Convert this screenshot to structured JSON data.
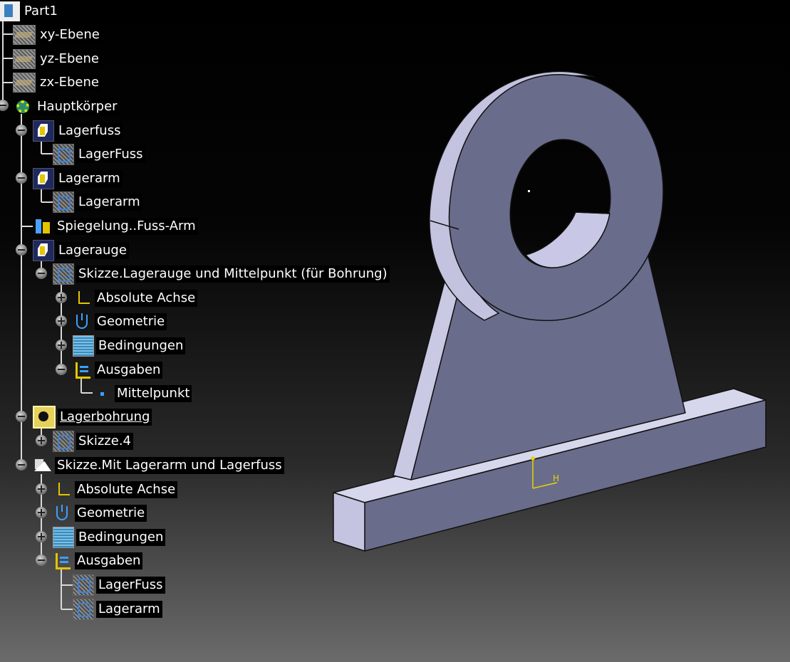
{
  "tree": {
    "root": {
      "label": "Part1",
      "icon": "part-icon"
    },
    "nodes": [
      {
        "label": "xy-Ebene",
        "icon": "plane-icon"
      },
      {
        "label": "yz-Ebene",
        "icon": "plane-icon"
      },
      {
        "label": "zx-Ebene",
        "icon": "plane-icon"
      },
      {
        "label": "Hauptkörper",
        "icon": "body-icon"
      },
      {
        "label": "Lagerfuss",
        "icon": "pad-icon"
      },
      {
        "label": "LagerFuss",
        "icon": "sketch-icon"
      },
      {
        "label": "Lagerarm",
        "icon": "pad-icon"
      },
      {
        "label": "Lagerarm",
        "icon": "sketch-icon"
      },
      {
        "label": "Spiegelung..Fuss-Arm",
        "icon": "mirror-icon"
      },
      {
        "label": "Lagerauge",
        "icon": "pad-icon"
      },
      {
        "label": "Skizze.Lagerauge und Mittelpunkt (für Bohrung)",
        "icon": "sketch-icon"
      },
      {
        "label": "Absolute Achse",
        "icon": "axis-icon"
      },
      {
        "label": "Geometrie",
        "icon": "geometry-icon"
      },
      {
        "label": "Bedingungen",
        "icon": "constraints-icon"
      },
      {
        "label": "Ausgaben",
        "icon": "output-icon"
      },
      {
        "label": "Mittelpunkt",
        "icon": "point-icon"
      },
      {
        "label": "Lagerbohrung",
        "icon": "pocket-icon"
      },
      {
        "label": "Skizze.4",
        "icon": "sketch-icon"
      },
      {
        "label": "Skizze.Mit Lagerarm und Lagerfuss",
        "icon": "sketch-plane-icon"
      },
      {
        "label": "Absolute Achse",
        "icon": "axis-icon"
      },
      {
        "label": "Geometrie",
        "icon": "geometry-icon"
      },
      {
        "label": "Bedingungen",
        "icon": "constraints-icon"
      },
      {
        "label": "Ausgaben",
        "icon": "output-icon"
      },
      {
        "label": "LagerFuss",
        "icon": "sketch-icon"
      },
      {
        "label": "Lagerarm",
        "icon": "sketch-icon"
      }
    ]
  },
  "viewport": {
    "axis_label": "H",
    "colors": {
      "face_light": "#d6d6ec",
      "face_mid": "#aeaed0",
      "face_dark": "#66688a",
      "axis": "#e6d400"
    }
  }
}
